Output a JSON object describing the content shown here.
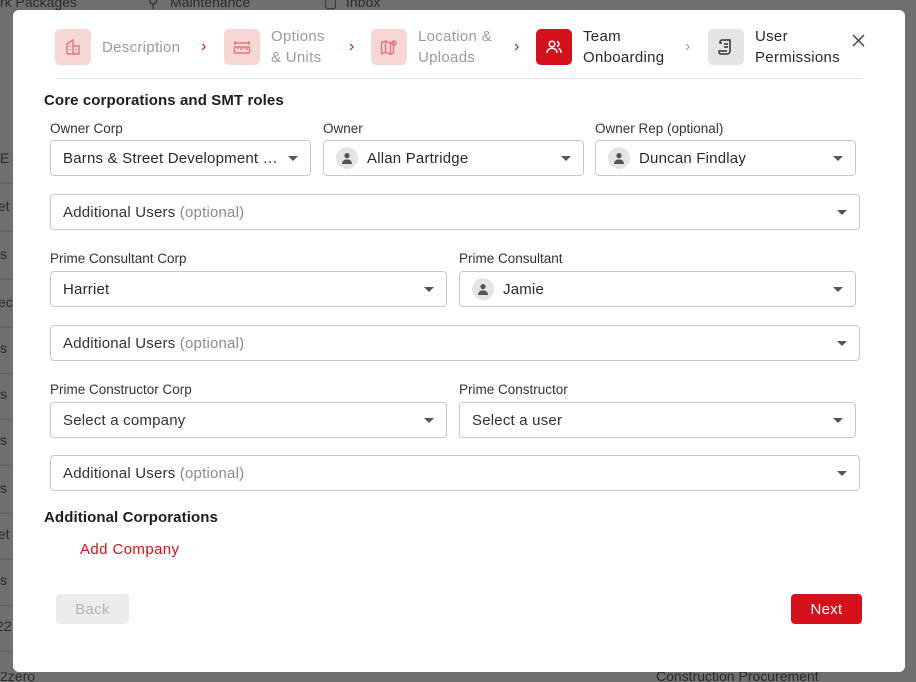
{
  "background": {
    "top_items": [
      "rk Packages",
      "Maintenance",
      "Inbox"
    ],
    "row_fragments": [
      "IE",
      "et",
      "s",
      "ec",
      "s",
      "s",
      "s",
      "s",
      "et",
      "s",
      "22"
    ],
    "bottom_left": "2zero",
    "bottom_right": "Construction Procurement"
  },
  "stepper": {
    "steps": [
      {
        "label_line1": "Description",
        "label_line2": "",
        "state": "done",
        "icon": "building-icon"
      },
      {
        "label_line1": "Options",
        "label_line2": "& Units",
        "state": "done",
        "icon": "ruler-icon"
      },
      {
        "label_line1": "Location &",
        "label_line2": "Uploads",
        "state": "done",
        "icon": "map-pin-icon"
      },
      {
        "label_line1": "Team",
        "label_line2": "Onboarding",
        "state": "active",
        "icon": "users-icon"
      },
      {
        "label_line1": "User",
        "label_line2": "Permissions",
        "state": "future",
        "icon": "document-icon"
      }
    ]
  },
  "sections": {
    "core_title": "Core corporations and SMT roles",
    "additional_title": "Additional Corporations"
  },
  "fields": {
    "owner_corp": {
      "label": "Owner Corp",
      "value": "Barns & Street Development & Construction"
    },
    "owner": {
      "label": "Owner",
      "value": "Allan Partridge"
    },
    "owner_rep": {
      "label": "Owner Rep (optional)",
      "value": "Duncan Findlay"
    },
    "additional_users_1": {
      "label": "Additional Users",
      "suffix": "(optional)"
    },
    "prime_consultant_corp": {
      "label": "Prime Consultant Corp",
      "value": "Harriet"
    },
    "prime_consultant": {
      "label": "Prime Consultant",
      "value": "Jamie"
    },
    "additional_users_2": {
      "label": "Additional Users",
      "suffix": "(optional)"
    },
    "prime_constructor_corp": {
      "label": "Prime Constructor Corp",
      "placeholder": "Select a company"
    },
    "prime_constructor": {
      "label": "Prime Constructor",
      "placeholder": "Select a user"
    },
    "additional_users_3": {
      "label": "Additional Users",
      "suffix": "(optional)"
    }
  },
  "actions": {
    "add_company": "Add Company",
    "back": "Back",
    "next": "Next"
  },
  "colors": {
    "accent": "#d4111a",
    "accent_light": "#f7d6d6",
    "border": "#c9c9c9"
  }
}
